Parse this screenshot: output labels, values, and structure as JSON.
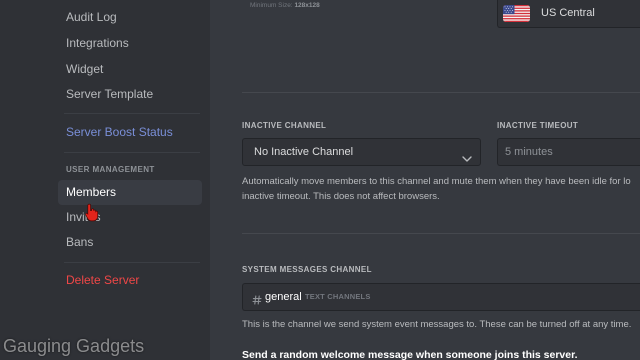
{
  "colors": {
    "sidebar_bg": "#2f3136",
    "main_bg": "#36393f",
    "boost_text": "#7a8fd8",
    "danger_text": "#f04747",
    "cursor_red": "#e3241b"
  },
  "sidebar": {
    "items": [
      {
        "label": "Audit Log"
      },
      {
        "label": "Integrations"
      },
      {
        "label": "Widget"
      },
      {
        "label": "Server Template"
      }
    ],
    "boost_label": "Server Boost Status",
    "user_management": {
      "header": "USER MANAGEMENT",
      "items": [
        {
          "label": "Members",
          "selected": true
        },
        {
          "label": "Invites",
          "selected": false
        },
        {
          "label": "Bans",
          "selected": false
        }
      ]
    },
    "delete_label": "Delete Server"
  },
  "cursor_icon": "hand-cursor-icon",
  "main": {
    "icon_hint": {
      "label": "Minimum Size:",
      "value": "128x128"
    },
    "region": {
      "flag_icon": "us-flag-icon",
      "value": "US Central"
    },
    "inactive": {
      "channel_label": "INACTIVE CHANNEL",
      "channel_value": "No Inactive Channel",
      "channel_chevron_icon": "chevron-down-icon",
      "timeout_label": "INACTIVE TIMEOUT",
      "timeout_value": "5 minutes",
      "description_lines": [
        "Automatically move members to this channel and mute them when they have been idle for lo",
        "inactive timeout. This does not affect browsers."
      ]
    },
    "system": {
      "label": "SYSTEM MESSAGES CHANNEL",
      "channel_icon": "hash-icon",
      "channel_name": "general",
      "channel_category": "TEXT CHANNELS",
      "description": "This is the channel we send system event messages to. These can be turned off at any time.",
      "welcome_label": "Send a random welcome message when someone joins this server."
    }
  },
  "watermark": "Gauging Gadgets"
}
